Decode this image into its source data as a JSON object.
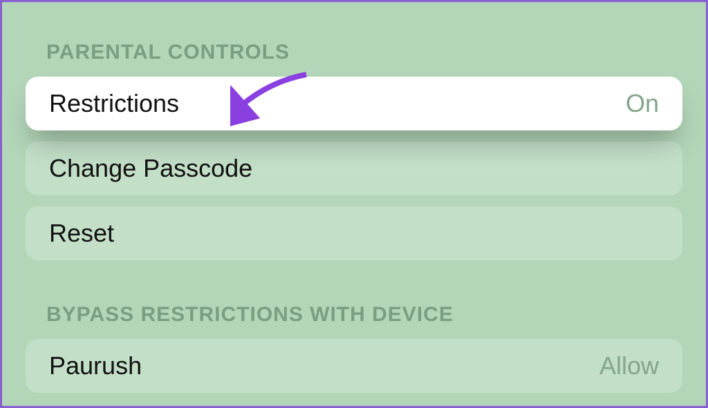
{
  "sections": {
    "parental": {
      "header": "PARENTAL CONTROLS",
      "restrictions": {
        "label": "Restrictions",
        "value": "On"
      },
      "changePasscode": {
        "label": "Change Passcode"
      },
      "reset": {
        "label": "Reset"
      }
    },
    "bypass": {
      "header": "BYPASS RESTRICTIONS WITH DEVICE",
      "device": {
        "label": "Paurush",
        "value": "Allow"
      }
    }
  },
  "annotation": {
    "arrowColor": "#8a3fe0"
  }
}
